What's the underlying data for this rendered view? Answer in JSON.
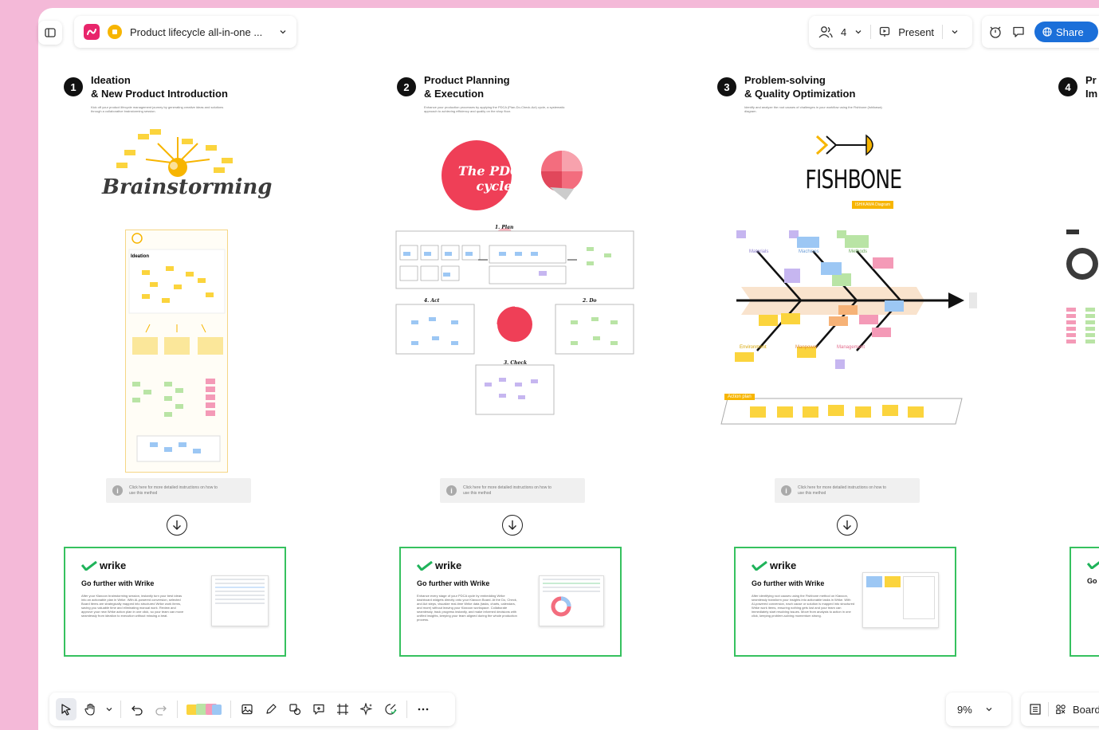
{
  "header": {
    "board_title": "Product lifecycle all-in-one ...",
    "collaborators": "4",
    "present_label": "Present",
    "share_label": "Share"
  },
  "steps": [
    {
      "number": "1",
      "title_line1": "Ideation",
      "title_line2": "& New Product Introduction",
      "description": "Kick off your product lifecycle management journey by generating creative ideas and solutions through a collaborative brainstorming session.",
      "art_title": "Brainstorming",
      "instructions": "Click here for more detailed instructions on how to use this method",
      "wrike_logo": "wrike",
      "wrike_heading": "Go further with Wrike",
      "wrike_body": "After your Klaxoon brainstorming session, instantly turn your best ideas into an actionable plan in Wrike. With AI-powered conversion, selected Board items are strategically mapped into structured Wrike work items, saving you valuable time and eliminating manual work. Review and approve your new Wrike action plan in one click, so your team can move seamlessly from ideation to execution without missing a beat."
    },
    {
      "number": "2",
      "title_line1": "Product Planning",
      "title_line2": "& Execution",
      "description": "Enhance your production processes by applying the PDCA (Plan-Do-Check-Act) cycle, a systematic approach to achieving efficiency and quality on the shop floor.",
      "art_title": "The PDCA cycle",
      "plan_label": "1. Plan",
      "do_label": "2. Do",
      "check_label": "3. Check",
      "act_label": "4. Act",
      "instructions": "Click here for more detailed instructions on how to use this method",
      "wrike_logo": "wrike",
      "wrike_heading": "Go further with Wrike",
      "wrike_body": "Enhance every stage of your PDCA cycle by embedding Wrike dashboard widgets directly onto your Klaxoon Board. At the Do, Check, and Act steps, visualize real-time Wrike data (tasks, charts, calendars, and more) without leaving your Klaxoon workspace. Collaborate seamlessly, track progress instantly, and make informed decisions with unified insights, keeping your team aligned during the whole production process."
    },
    {
      "number": "3",
      "title_line1": "Problem-solving",
      "title_line2": "& Quality Optimization",
      "description": "Identify and analyze the root causes of challenges in your workflow using the Fishbone (Ishikawa) diagram.",
      "art_title": "FISHBONE",
      "art_subtitle": "ISHIKAWA Diagram",
      "fish_labels": [
        "Materials",
        "Machines",
        "Methods",
        "Environment",
        "Manpower",
        "Management"
      ],
      "action_plan_label": "Action plan",
      "instructions": "Click here for more detailed instructions on how to use this method",
      "wrike_logo": "wrike",
      "wrike_heading": "Go further with Wrike",
      "wrike_body": "After identifying root causes using the Fishbone method on Klaxoon, seamlessly transform your insights into actionable tasks in Wrike. With AI-powered conversion, each cause or solution is mapped into structured Wrike work items, ensuring nothing gets lost and your team can immediately start resolving issues. Move from analysis to action in one click, keeping problem-solving momentum strong."
    },
    {
      "number": "4",
      "title_line1": "Pr",
      "title_line2": "Im",
      "wrike_heading": "Go"
    }
  ],
  "footer": {
    "zoom": "9%",
    "view_label": "Board"
  }
}
